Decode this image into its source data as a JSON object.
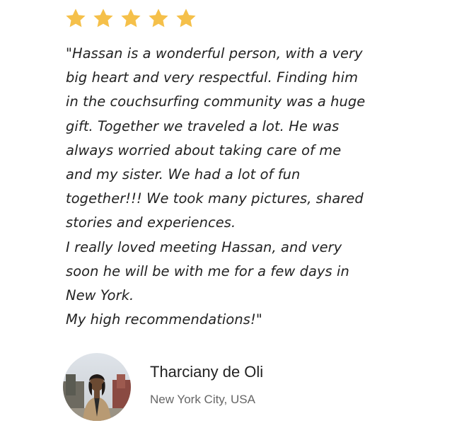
{
  "rating": {
    "value": 5,
    "max": 5,
    "star_color": "#f5c04a"
  },
  "testimonial": {
    "lines": [
      "\"Hassan is a wonderful person, with a very",
      "big heart and very respectful. Finding him",
      "in the couchsurfing community was a huge",
      "gift. Together we traveled a lot. He was",
      "always worried about taking care of me",
      "and my sister. We had a lot of fun",
      "together!!! We took many pictures, shared",
      "stories and experiences.",
      "I really loved meeting Hassan, and very",
      "soon he will be with me for a few days in",
      "New York.",
      "My high recommendations!\""
    ]
  },
  "author": {
    "name": "Tharciany de Oli",
    "location": "New York City, USA",
    "avatar_icon": "person-photo"
  }
}
